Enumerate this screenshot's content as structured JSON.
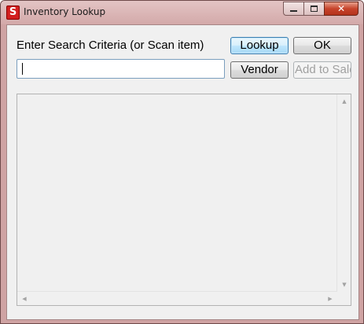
{
  "window": {
    "title": "Inventory Lookup",
    "icon_letter": "S",
    "icon": "app-logo-icon",
    "controls": {
      "minimize_icon": "minimize-icon",
      "maximize_icon": "maximize-icon",
      "close_icon": "close-icon",
      "close_glyph": "✕"
    },
    "accent_color": "#d21f1f"
  },
  "search": {
    "label": "Enter Search Criteria (or Scan item)",
    "value": "",
    "placeholder": ""
  },
  "buttons": {
    "lookup": "Lookup",
    "ok": "OK",
    "vendor": "Vendor",
    "add_to_sale": "Add to Sale"
  },
  "results": {
    "rows": [],
    "scroll_up": "▲",
    "scroll_down": "▼",
    "scroll_left": "◀",
    "scroll_right": "▶"
  }
}
